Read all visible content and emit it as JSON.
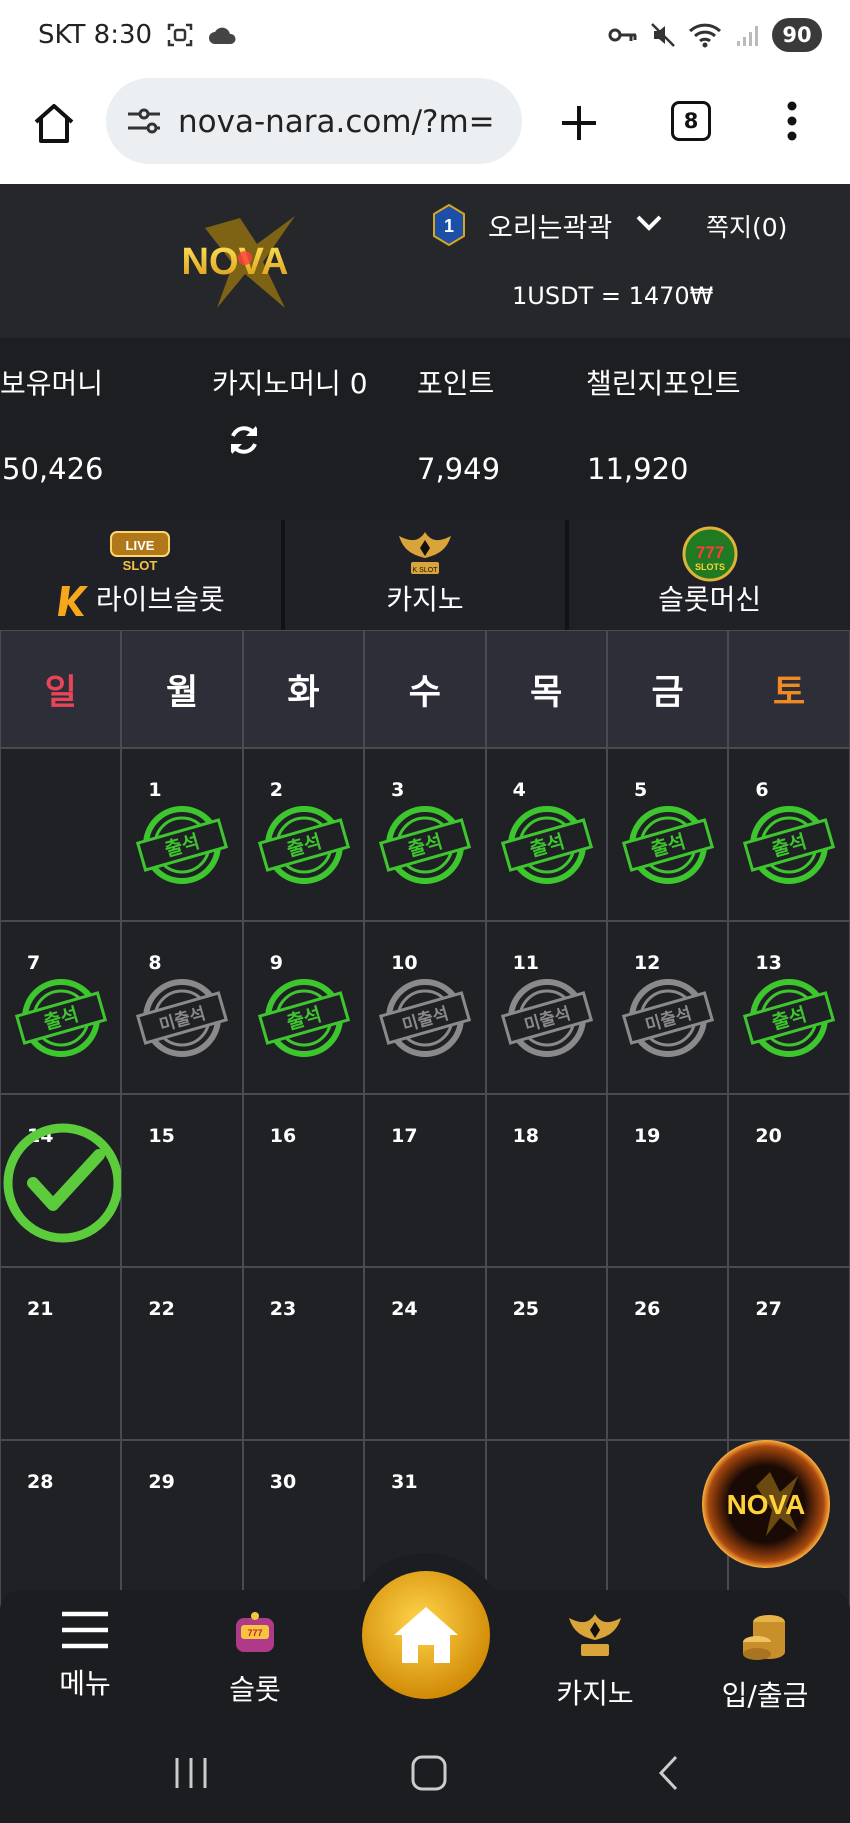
{
  "status": {
    "carrier_time": "SKT 8:30",
    "battery": "90"
  },
  "browser": {
    "url": "nova-nara.com/?m=",
    "tab_count": "8"
  },
  "header": {
    "username": "오리는곽곽",
    "level": "1",
    "notes": "쪽지(0)",
    "rate": "1USDT = 1470₩",
    "logo_text": "NOVA"
  },
  "balance": {
    "money_label": "보유머니",
    "money_value": "50,426",
    "casino_label": "카지노머니 0",
    "point_label": "포인트",
    "point_value": "7,949",
    "challenge_label": "챌린지포인트",
    "challenge_value": "11,920"
  },
  "games": [
    {
      "label": "라이브슬롯",
      "icon": "live-slot-icon"
    },
    {
      "label": "카지노",
      "icon": "casino-icon"
    },
    {
      "label": "슬롯머신",
      "icon": "slot-machine-icon"
    }
  ],
  "calendar": {
    "weekdays": [
      "일",
      "월",
      "화",
      "수",
      "목",
      "금",
      "토"
    ],
    "stamp_present": "출석",
    "stamp_absent": "미출석",
    "colors": {
      "sunday": "#e8455a",
      "saturday": "#f08a24",
      "present": "#3ec62f",
      "absent": "#8a8a8a"
    },
    "days": [
      [
        "",
        "1",
        "2",
        "3",
        "4",
        "5",
        "6"
      ],
      [
        "7",
        "8",
        "9",
        "10",
        "11",
        "12",
        "13"
      ],
      [
        "14",
        "15",
        "16",
        "17",
        "18",
        "19",
        "20"
      ],
      [
        "21",
        "22",
        "23",
        "24",
        "25",
        "26",
        "27"
      ],
      [
        "28",
        "29",
        "30",
        "31",
        "",
        "",
        ""
      ]
    ]
  },
  "bottom_nav": {
    "menu": "메뉴",
    "slot": "슬롯",
    "casino": "카지노",
    "deposit": "입/출금"
  }
}
